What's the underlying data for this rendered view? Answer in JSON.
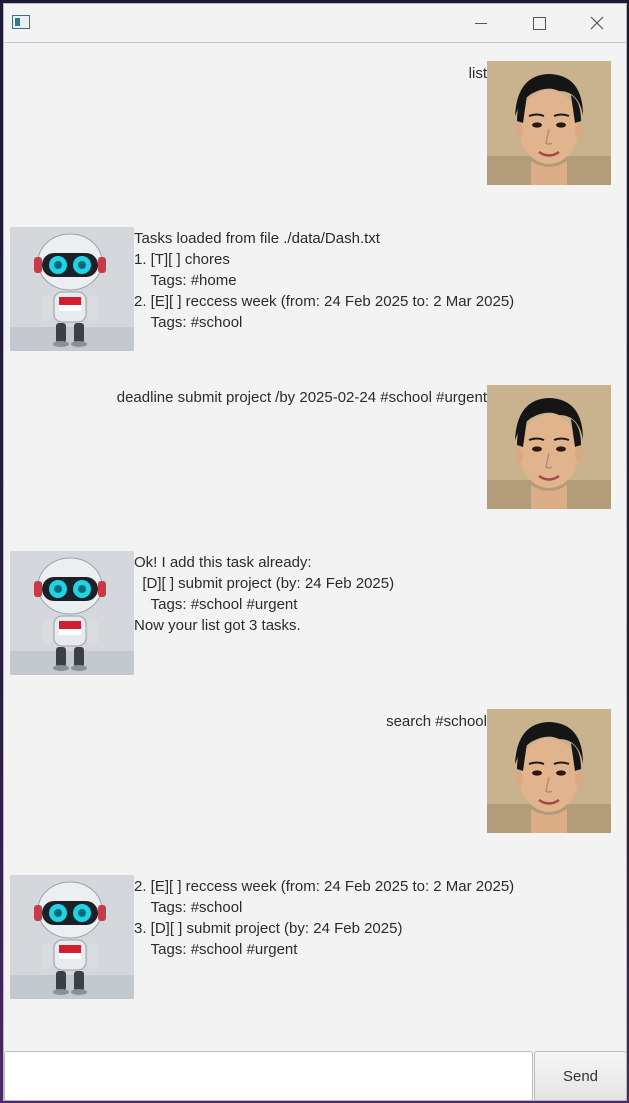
{
  "window": {
    "title": ""
  },
  "messages": [
    {
      "from": "user",
      "text": "list"
    },
    {
      "from": "bot",
      "text": "Tasks loaded from file ./data/Dash.txt\n1. [T][ ] chores\n\tTags: #home\n2. [E][ ] reccess week (from: 24 Feb 2025 to: 2 Mar 2025)\n\tTags: #school"
    },
    {
      "from": "user",
      "text": "deadline submit project /by 2025-02-24 #school #urgent"
    },
    {
      "from": "bot",
      "text": "Ok! I add this task already:\n  [D][ ] submit project (by: 24 Feb 2025)\n\tTags: #school #urgent\nNow your list got 3 tasks."
    },
    {
      "from": "user",
      "text": "search #school"
    },
    {
      "from": "bot",
      "text": "2. [E][ ] reccess week (from: 24 Feb 2025 to: 2 Mar 2025)\n\tTags: #school\n3. [D][ ] submit project (by: 24 Feb 2025)\n\tTags: #school #urgent"
    }
  ],
  "input": {
    "value": "",
    "placeholder": ""
  },
  "send_label": "Send",
  "colors": {
    "window_bg": "#f3f3f3",
    "text": "#2b2b2b"
  },
  "icons": {
    "user_avatar": "user-avatar-icon",
    "bot_avatar": "robot-avatar-icon"
  }
}
